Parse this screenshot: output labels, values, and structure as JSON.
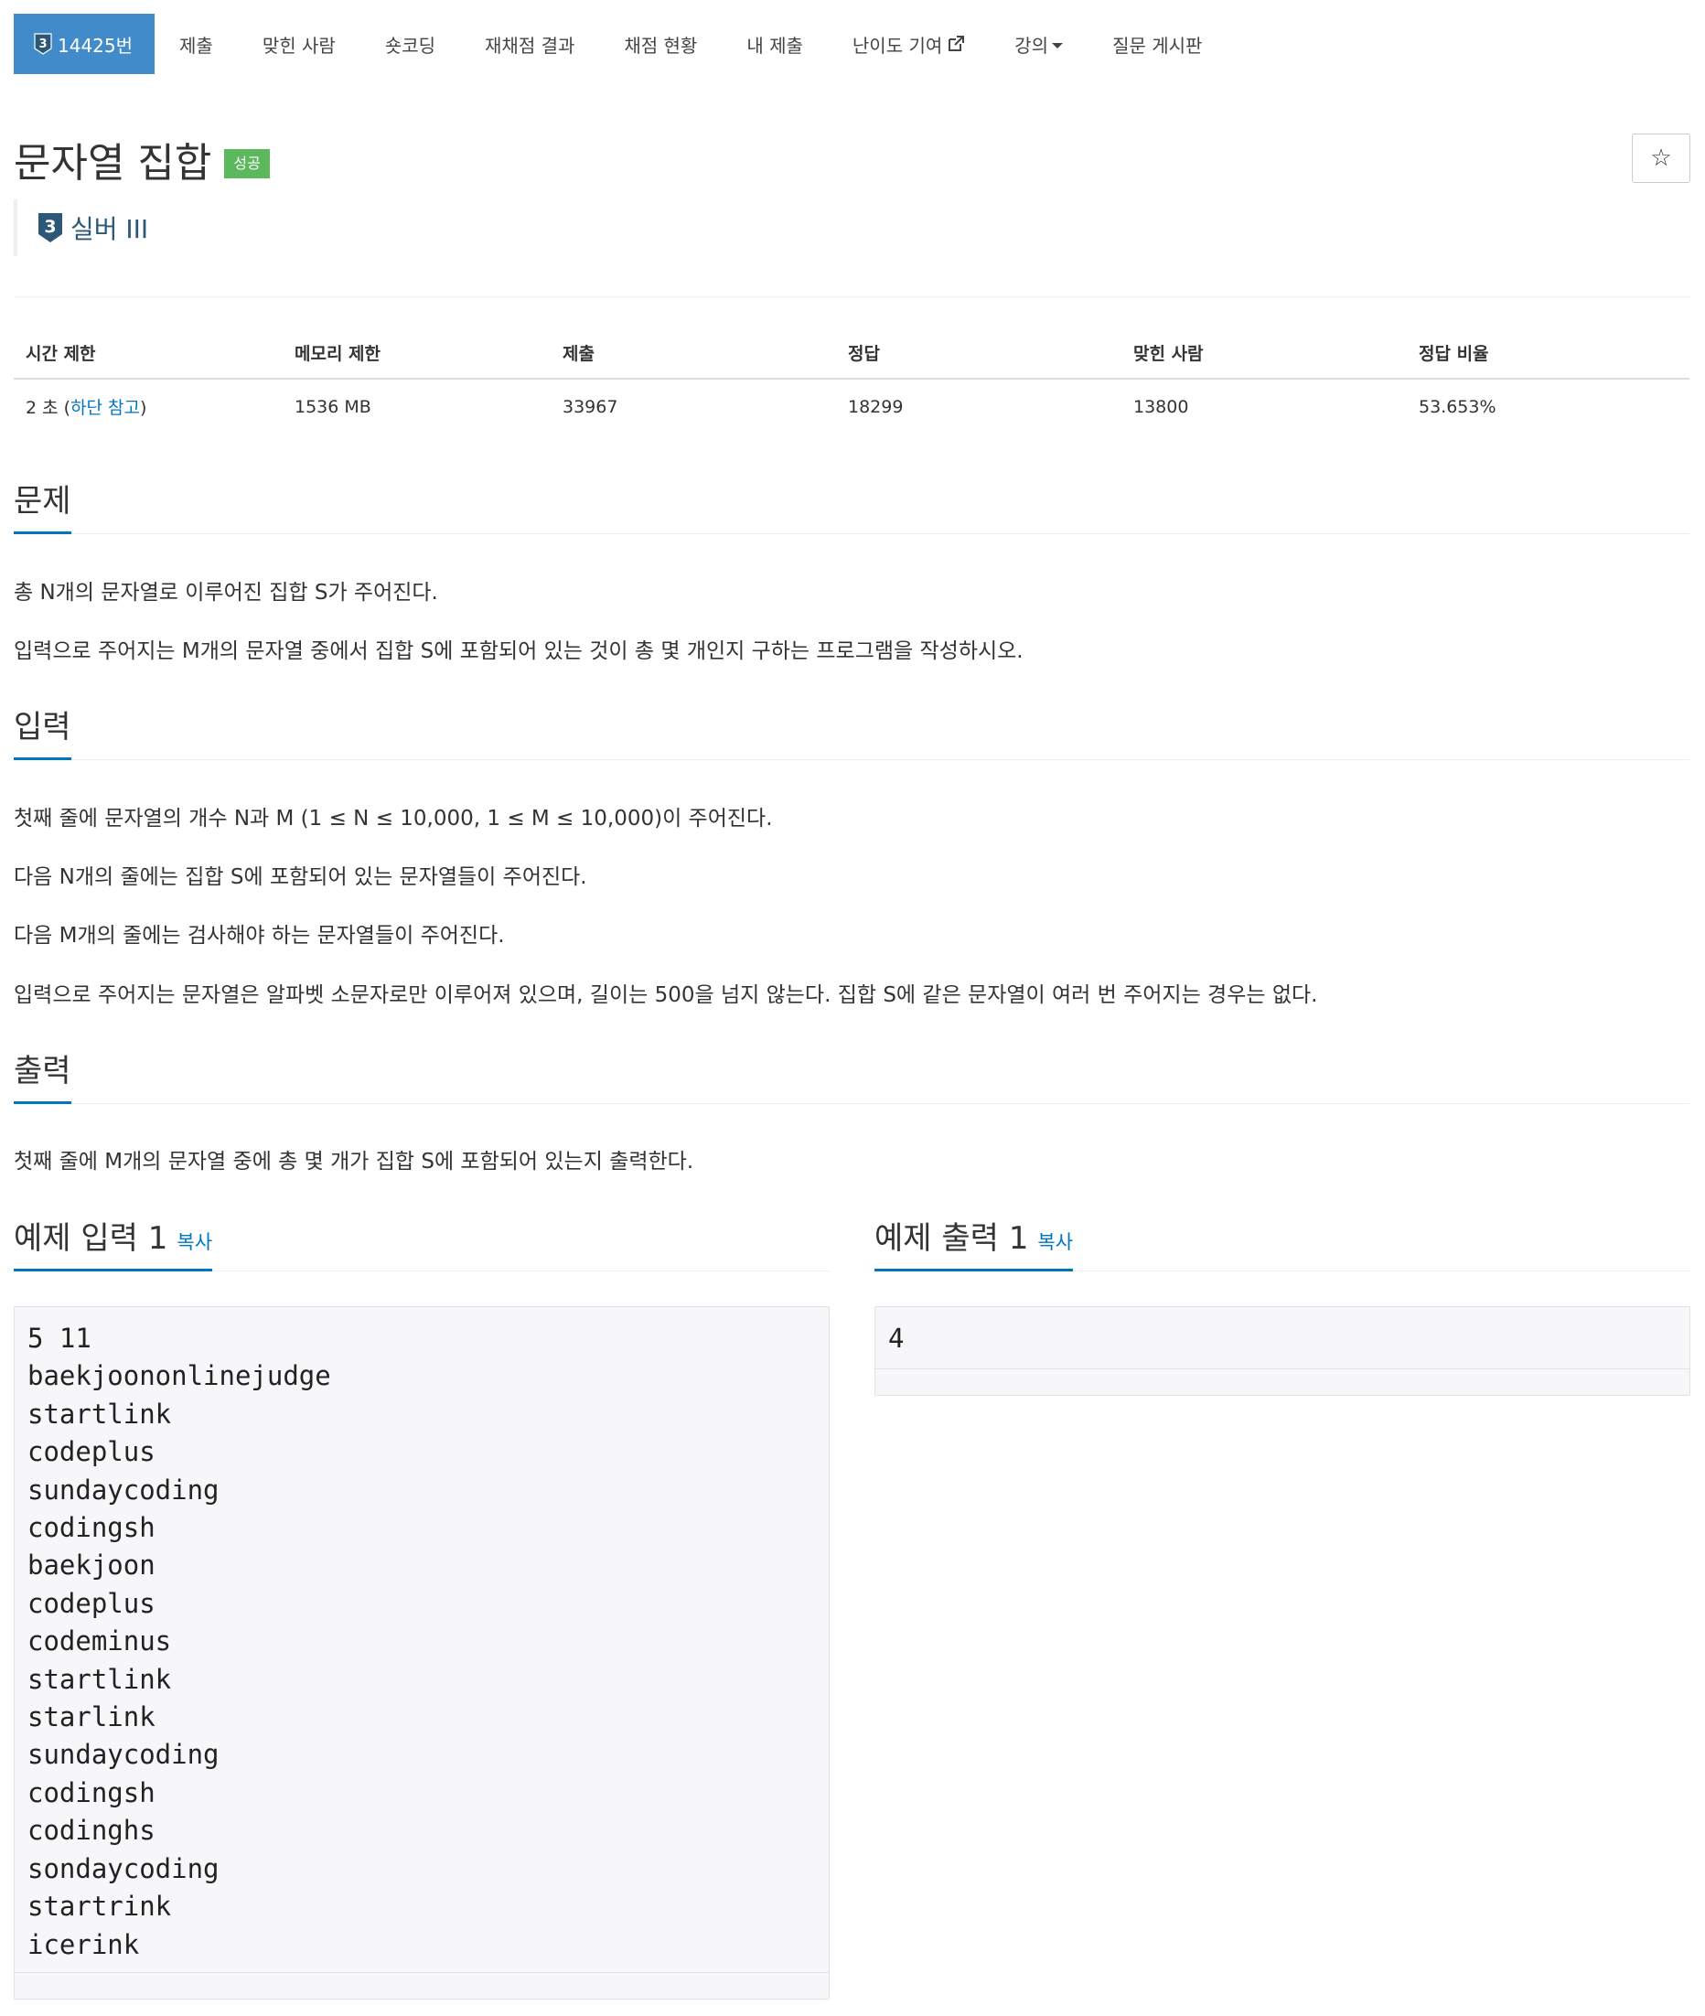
{
  "nav": {
    "tier_level": "3",
    "problem_number": "14425번",
    "items": [
      "제출",
      "맞힌 사람",
      "숏코딩",
      "재채점 결과",
      "채점 현황",
      "내 제출",
      "난이도 기여",
      "강의",
      "질문 게시판"
    ]
  },
  "colors": {
    "primary": "#428bca",
    "success": "#5cb85c",
    "link": "#0076c0",
    "tier": "#2c5777"
  },
  "problem": {
    "title": "문자열 집합",
    "result": "성공",
    "star": "☆",
    "tier_level": "3",
    "tier_name": "실버 III"
  },
  "info": {
    "headers": [
      "시간 제한",
      "메모리 제한",
      "제출",
      "정답",
      "맞힌 사람",
      "정답 비율"
    ],
    "time_prefix": "2 초 (",
    "time_link": "하단 참고",
    "time_suffix": ")",
    "values": [
      "1536 MB",
      "33967",
      "18299",
      "13800",
      "53.653%"
    ]
  },
  "sections": {
    "problem": {
      "heading": "문제",
      "paragraphs": [
        "총 N개의 문자열로 이루어진 집합 S가 주어진다.",
        "입력으로 주어지는 M개의 문자열 중에서 집합 S에 포함되어 있는 것이 총 몇 개인지 구하는 프로그램을 작성하시오."
      ]
    },
    "input": {
      "heading": "입력",
      "paragraphs": [
        "첫째 줄에 문자열의 개수 N과 M (1 ≤ N ≤ 10,000, 1 ≤ M ≤ 10,000)이 주어진다.",
        "다음 N개의 줄에는 집합 S에 포함되어 있는 문자열들이 주어진다.",
        "다음 M개의 줄에는 검사해야 하는 문자열들이 주어진다.",
        "입력으로 주어지는 문자열은 알파벳 소문자로만 이루어져 있으며, 길이는 500을 넘지 않는다. 집합 S에 같은 문자열이 여러 번 주어지는 경우는 없다."
      ]
    },
    "output": {
      "heading": "출력",
      "paragraphs": [
        "첫째 줄에 M개의 문자열 중에 총 몇 개가 집합 S에 포함되어 있는지 출력한다."
      ]
    }
  },
  "samples": {
    "input": {
      "heading": "예제 입력 1",
      "copy": "복사",
      "lines": [
        "5 11",
        "baekjoononlinejudge",
        "startlink",
        "codeplus",
        "sundaycoding",
        "codingsh",
        "baekjoon",
        "codeplus",
        "codeminus",
        "startlink",
        "starlink",
        "sundaycoding",
        "codingsh",
        "codinghs",
        "sondaycoding",
        "startrink",
        "icerink"
      ]
    },
    "output": {
      "heading": "예제 출력 1",
      "copy": "복사",
      "lines": [
        "4"
      ]
    }
  }
}
